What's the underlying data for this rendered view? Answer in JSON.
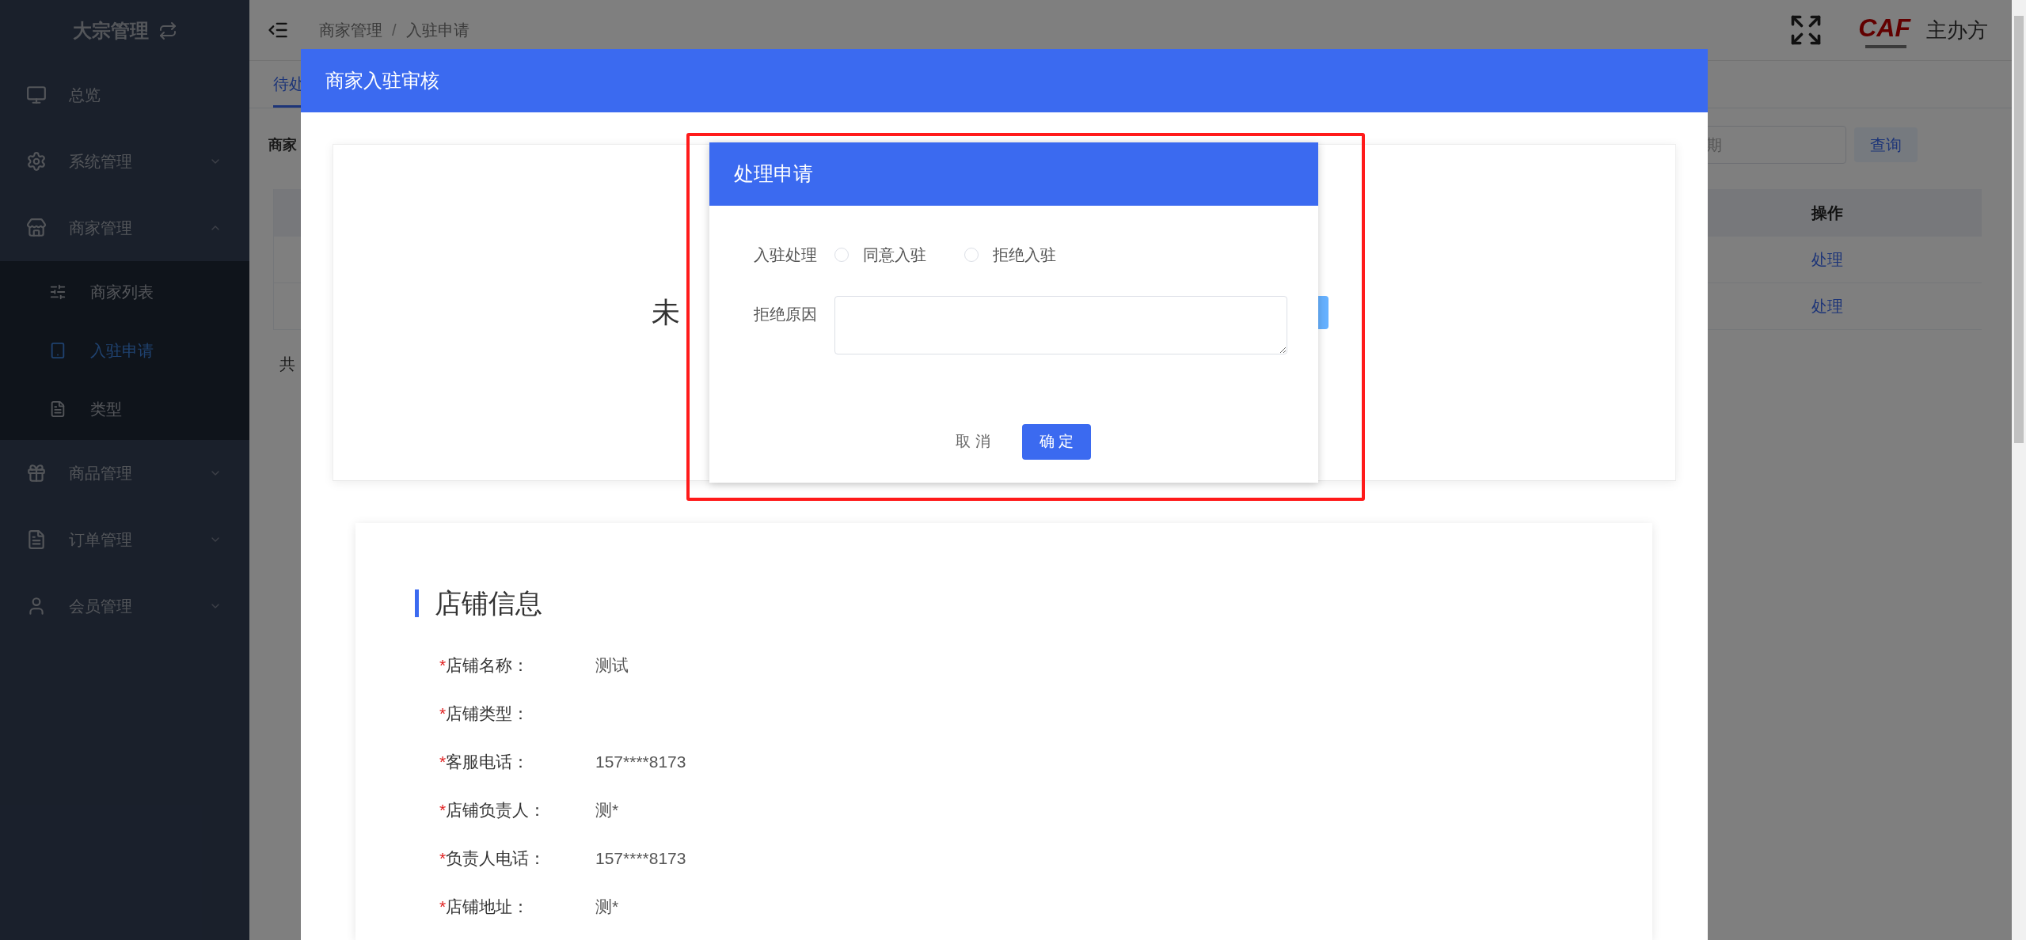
{
  "sidebar": {
    "title": "大宗管理",
    "items": [
      {
        "label": "总览"
      },
      {
        "label": "系统管理",
        "expanded": false
      },
      {
        "label": "商家管理",
        "expanded": true,
        "children": [
          {
            "label": "商家列表",
            "selected": false
          },
          {
            "label": "入驻申请",
            "selected": true
          },
          {
            "label": "类型",
            "selected": false
          }
        ]
      },
      {
        "label": "商品管理",
        "expanded": false
      },
      {
        "label": "订单管理",
        "expanded": false
      },
      {
        "label": "会员管理",
        "expanded": false
      }
    ]
  },
  "header": {
    "breadcrumb": [
      "商家管理",
      "入驻申请"
    ],
    "breadcrumb_separator": "/",
    "logo_text": "CAF",
    "host_label": "主办方"
  },
  "tabs": [
    {
      "label": "待处",
      "selected": true
    }
  ],
  "filter": {
    "label": "商家",
    "date_placeholder": "期",
    "query_button": "查询"
  },
  "table": {
    "columns": [
      "操作"
    ],
    "rows": [
      {
        "action": "处理"
      },
      {
        "action": "处理"
      }
    ]
  },
  "pagination": {
    "text": "共"
  },
  "review_modal": {
    "title": "商家入驻审核",
    "status_text": "未",
    "store_info": {
      "heading": "店铺信息",
      "fields": [
        {
          "mark": "*",
          "label": "店铺名称：",
          "value": "测试"
        },
        {
          "mark": "*",
          "label": "店铺类型："
        },
        {
          "mark": "*",
          "label": "客服电话：",
          "value": "157****8173"
        },
        {
          "mark": "*",
          "label": "店铺负责人：",
          "value": "测*"
        },
        {
          "mark": "*",
          "label": "负责人电话：",
          "value": "157****8173"
        },
        {
          "mark": "*",
          "label": "店铺地址：",
          "value": "测*"
        }
      ]
    }
  },
  "process_dialog": {
    "title": "处理申请",
    "decision": {
      "label": "入驻处理",
      "options": [
        {
          "label": "同意入驻",
          "selected": false
        },
        {
          "label": "拒绝入驻",
          "selected": false
        }
      ]
    },
    "reason": {
      "label": "拒绝原因"
    },
    "cancel_button": "取 消",
    "confirm_button": "确 定"
  }
}
